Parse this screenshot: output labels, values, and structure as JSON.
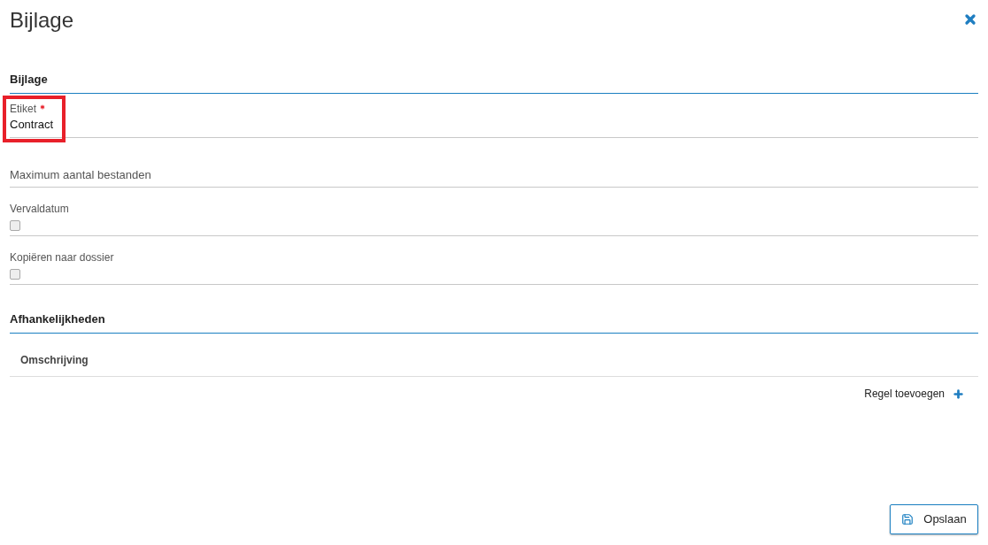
{
  "dialog": {
    "title": "Bijlage"
  },
  "sections": [
    {
      "heading": "Bijlage",
      "fields": [
        {
          "kind": "text",
          "label": "Etiket",
          "required": true,
          "highlighted": true,
          "value": "Contract"
        },
        {
          "kind": "number",
          "label": "Maximum aantal bestanden",
          "required": false,
          "highlighted": false
        },
        {
          "kind": "checkbox",
          "label": "Vervaldatum",
          "required": false,
          "highlighted": false,
          "checked": false
        },
        {
          "kind": "checkbox",
          "label": "Kopiëren naar dossier",
          "required": false,
          "highlighted": false,
          "checked": false
        }
      ]
    }
  ],
  "dependencies": {
    "heading": "Afhankelijkheden",
    "columns": [
      "Omschrijving"
    ],
    "add_row": "Regel toevoegen"
  },
  "footer": {
    "save_button": "Opslaan"
  }
}
